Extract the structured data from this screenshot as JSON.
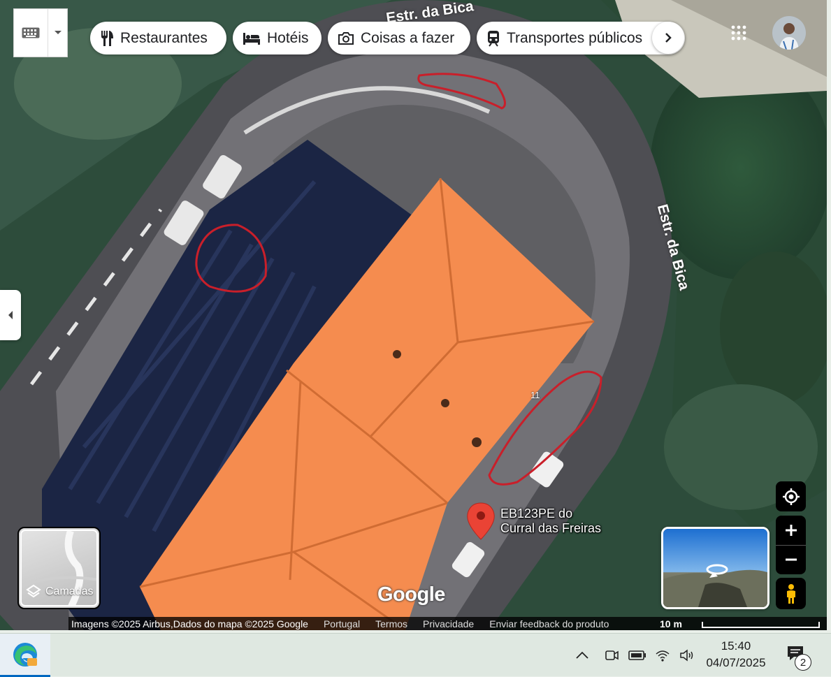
{
  "chips": [
    {
      "label": "Restaurantes",
      "icon": "fork-knife-icon"
    },
    {
      "label": "Hotéis",
      "icon": "bed-icon"
    },
    {
      "label": "Coisas a fazer",
      "icon": "camera-icon"
    },
    {
      "label": "Transportes públicos",
      "icon": "train-icon"
    }
  ],
  "map": {
    "road_labels": [
      "Estr. da Bica",
      "Estr. da Bica"
    ],
    "building_number": "11",
    "pin": {
      "line1": "EB123PE do",
      "line2": "Curral das Freiras",
      "color": "#ea4335"
    },
    "logo": "Google",
    "roof_color": "#f58c4f"
  },
  "layers": {
    "label": "Camadas"
  },
  "attribution": {
    "imagery": "Imagens ©2025 Airbus,Dados do mapa ©2025 Google",
    "links": [
      "Portugal",
      "Termos",
      "Privacidade",
      "Enviar feedback do produto"
    ],
    "scale": "10 m"
  },
  "taskbar": {
    "time": "15:40",
    "date": "04/07/2025",
    "notifications": "2",
    "accent": "#0067c0"
  }
}
